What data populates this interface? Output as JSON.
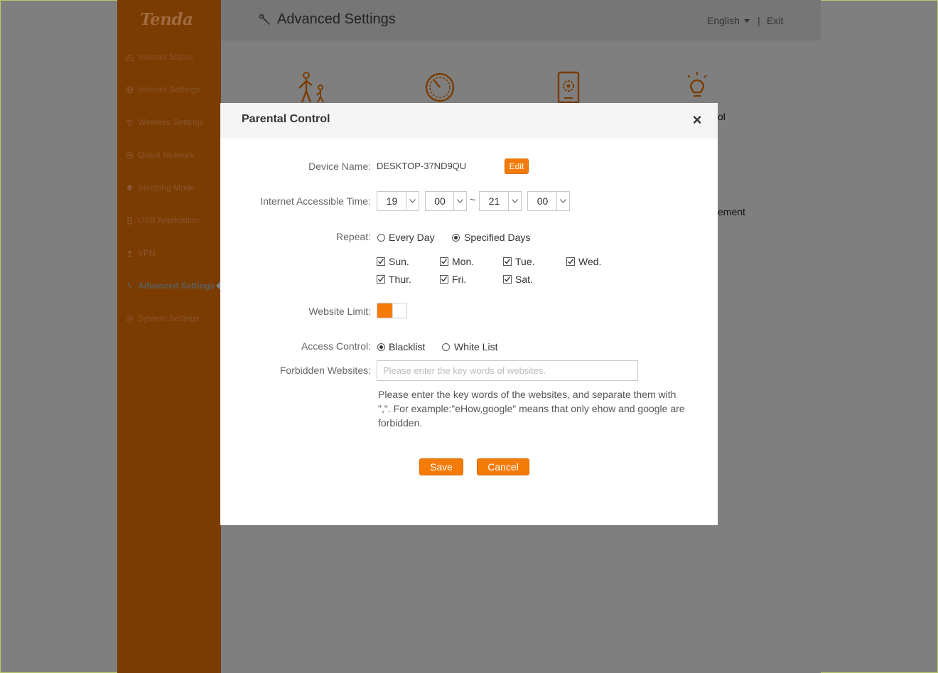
{
  "sidebar": {
    "logo": "Tenda",
    "items": [
      {
        "label": "Internet Status",
        "icon": "router-icon"
      },
      {
        "label": "Internet Settings",
        "icon": "globe-icon"
      },
      {
        "label": "Wireless Settings",
        "icon": "wifi-icon"
      },
      {
        "label": "Guest Network",
        "icon": "guest-icon"
      },
      {
        "label": "Sleeping Mode",
        "icon": "moon-icon"
      },
      {
        "label": "USB Application",
        "icon": "usb-icon"
      },
      {
        "label": "VPN",
        "icon": "vpn-icon"
      },
      {
        "label": "Advanced Settings",
        "icon": "wrench-icon",
        "active": true
      },
      {
        "label": "System Settings",
        "icon": "gear-icon"
      }
    ]
  },
  "header": {
    "title": "Advanced Settings",
    "language": "English",
    "separator": "|",
    "exit": "Exit"
  },
  "background": {
    "label_right_top": "ol",
    "label_right_mid": "ement"
  },
  "modal": {
    "title": "Parental Control",
    "close": "×",
    "device_name_label": "Device Name:",
    "device_name_value": "DESKTOP-37ND9QU",
    "edit_label": "Edit",
    "time_label": "Internet Accessible Time:",
    "time": {
      "start_hour": "19",
      "start_min": "00",
      "end_hour": "21",
      "end_min": "00",
      "separator": "~"
    },
    "repeat_label": "Repeat:",
    "repeat_options": {
      "every_day": "Every Day",
      "specified_days": "Specified Days",
      "selected": "specified_days"
    },
    "days": [
      {
        "label": "Sun.",
        "checked": true
      },
      {
        "label": "Mon.",
        "checked": true
      },
      {
        "label": "Tue.",
        "checked": true
      },
      {
        "label": "Wed.",
        "checked": true
      },
      {
        "label": "Thur.",
        "checked": true
      },
      {
        "label": "Fri.",
        "checked": true
      },
      {
        "label": "Sat.",
        "checked": true
      }
    ],
    "website_limit_label": "Website Limit:",
    "website_limit_on": true,
    "access_control_label": "Access Control:",
    "access_options": {
      "blacklist": "Blacklist",
      "whitelist": "White List",
      "selected": "blacklist"
    },
    "forbidden_label": "Forbidden Websites:",
    "forbidden_placeholder": "Please enter the key words of websites.",
    "forbidden_value": "",
    "hint": "Please enter the key words of the websites, and separate them with \",\". For example:\"eHow,google\" means that only ehow and google are forbidden.",
    "save_label": "Save",
    "cancel_label": "Cancel"
  },
  "colors": {
    "accent": "#f57b08",
    "sidebar_bg": "#7a3c00",
    "overlay": "#7f7f7f"
  }
}
